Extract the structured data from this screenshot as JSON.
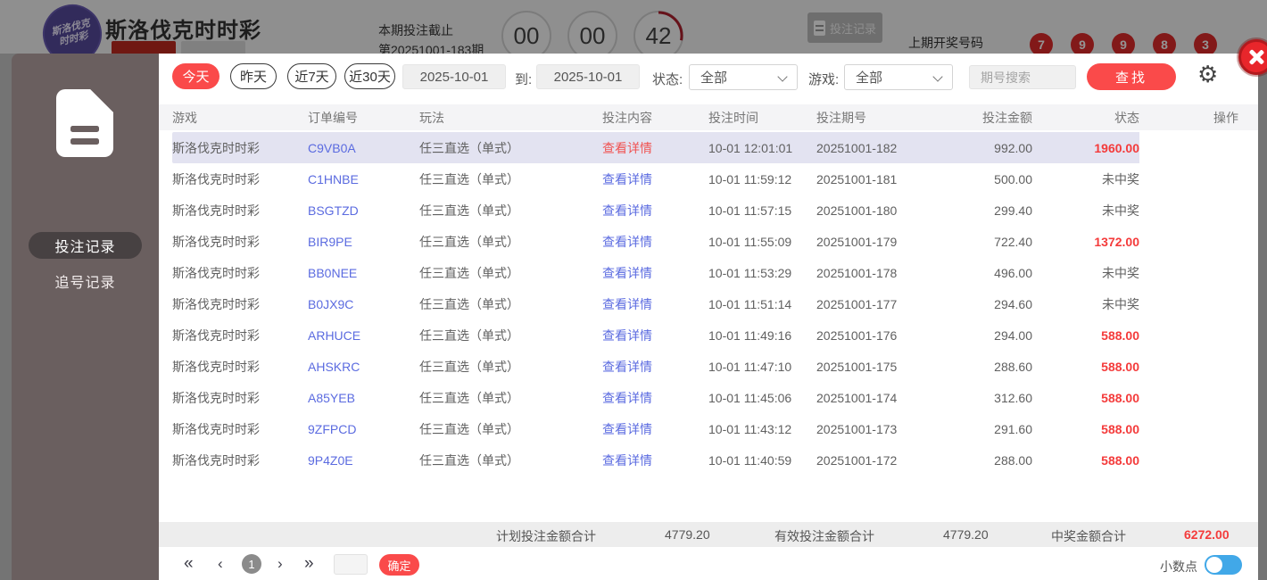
{
  "background": {
    "title": "斯洛伐克时时彩",
    "logo_line1": "斯洛伐克",
    "logo_line2": "时时彩",
    "deadline_label": "本期投注截止",
    "issue_label": "第20251001-183期",
    "countdown": {
      "hours": "00",
      "minutes": "00",
      "seconds": "42"
    },
    "bet_record_button": "投注记录",
    "last_draw_label": "上期开奖号码",
    "last_draw_numbers": [
      "7",
      "9",
      "9",
      "8",
      "3"
    ]
  },
  "sidebar": {
    "items": [
      {
        "label": "投注记录",
        "active": true
      },
      {
        "label": "追号记录",
        "active": false
      }
    ]
  },
  "filters": {
    "quick": [
      {
        "label": "今天",
        "active": true
      },
      {
        "label": "昨天",
        "active": false
      },
      {
        "label": "近7天",
        "active": false
      },
      {
        "label": "近30天",
        "active": false
      }
    ],
    "date_from": "2025-10-01",
    "to_label": "到:",
    "date_to": "2025-10-01",
    "status_label": "状态:",
    "status_value": "全部",
    "game_label": "游戏:",
    "game_value": "全部",
    "search_placeholder": "期号搜索",
    "search_button": "查找"
  },
  "icons": {
    "gear": "⚙"
  },
  "table": {
    "columns": [
      "游戏",
      "订单编号",
      "玩法",
      "投注内容",
      "投注时间",
      "投注期号",
      "投注金额",
      "状态",
      "操作"
    ],
    "detail_link": "查看详情",
    "rows": [
      {
        "game": "斯洛伐克时时彩",
        "order": "C9VB0A",
        "play": "任三直选（单式）",
        "time": "10-01 12:01:01",
        "issue": "20251001-182",
        "amount": "992.00",
        "status": "1960.00",
        "win": true,
        "highlight": true,
        "detail_red": true
      },
      {
        "game": "斯洛伐克时时彩",
        "order": "C1HNBE",
        "play": "任三直选（单式）",
        "time": "10-01 11:59:12",
        "issue": "20251001-181",
        "amount": "500.00",
        "status": "未中奖",
        "win": false
      },
      {
        "game": "斯洛伐克时时彩",
        "order": "BSGTZD",
        "play": "任三直选（单式）",
        "time": "10-01 11:57:15",
        "issue": "20251001-180",
        "amount": "299.40",
        "status": "未中奖",
        "win": false
      },
      {
        "game": "斯洛伐克时时彩",
        "order": "BIR9PE",
        "play": "任三直选（单式）",
        "time": "10-01 11:55:09",
        "issue": "20251001-179",
        "amount": "722.40",
        "status": "1372.00",
        "win": true
      },
      {
        "game": "斯洛伐克时时彩",
        "order": "BB0NEE",
        "play": "任三直选（单式）",
        "time": "10-01 11:53:29",
        "issue": "20251001-178",
        "amount": "496.00",
        "status": "未中奖",
        "win": false
      },
      {
        "game": "斯洛伐克时时彩",
        "order": "B0JX9C",
        "play": "任三直选（单式）",
        "time": "10-01 11:51:14",
        "issue": "20251001-177",
        "amount": "294.60",
        "status": "未中奖",
        "win": false
      },
      {
        "game": "斯洛伐克时时彩",
        "order": "ARHUCE",
        "play": "任三直选（单式）",
        "time": "10-01 11:49:16",
        "issue": "20251001-176",
        "amount": "294.00",
        "status": "588.00",
        "win": true
      },
      {
        "game": "斯洛伐克时时彩",
        "order": "AHSKRC",
        "play": "任三直选（单式）",
        "time": "10-01 11:47:10",
        "issue": "20251001-175",
        "amount": "288.60",
        "status": "588.00",
        "win": true
      },
      {
        "game": "斯洛伐克时时彩",
        "order": "A85YEB",
        "play": "任三直选（单式）",
        "time": "10-01 11:45:06",
        "issue": "20251001-174",
        "amount": "312.60",
        "status": "588.00",
        "win": true
      },
      {
        "game": "斯洛伐克时时彩",
        "order": "9ZFPCD",
        "play": "任三直选（单式）",
        "time": "10-01 11:43:12",
        "issue": "20251001-173",
        "amount": "291.60",
        "status": "588.00",
        "win": true
      },
      {
        "game": "斯洛伐克时时彩",
        "order": "9P4Z0E",
        "play": "任三直选（单式）",
        "time": "10-01 11:40:59",
        "issue": "20251001-172",
        "amount": "288.00",
        "status": "588.00",
        "win": true
      }
    ]
  },
  "totals": {
    "plan_label": "计划投注金额合计",
    "plan_value": "4779.20",
    "valid_label": "有效投注金额合计",
    "valid_value": "4779.20",
    "win_label": "中奖金额合计",
    "win_value": "6272.00"
  },
  "pagination": {
    "first": "«",
    "prev": "‹",
    "current": "1",
    "next": "›",
    "last": "»",
    "confirm": "确定"
  },
  "footer": {
    "decimal_label": "小数点"
  },
  "colors": {
    "accent_red": "#fa4a4a",
    "link_blue": "#5b6be0",
    "win_red": "#f43b3b",
    "toggle_blue": "#41a8e8",
    "sidebar_bg": "#6a5f5f",
    "highlight_row": "#e3e3f1"
  }
}
